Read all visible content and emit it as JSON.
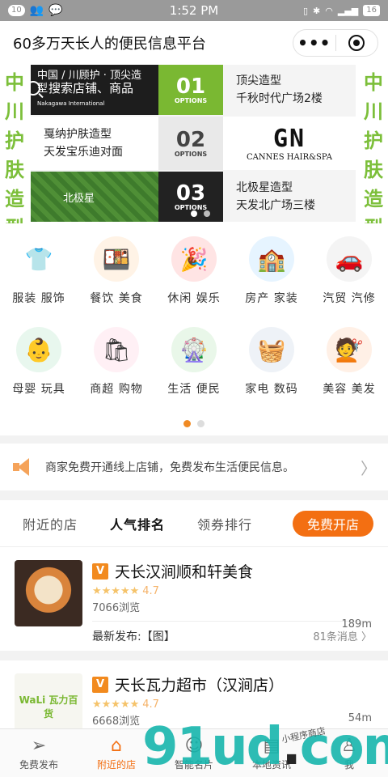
{
  "status": {
    "badge1": "10",
    "time": "1:52 PM",
    "battery": "16"
  },
  "header": {
    "title": "60多万天长人的便民信息平台"
  },
  "banner": {
    "side_left": [
      "中",
      "川",
      "护",
      "肤",
      "造",
      "型"
    ],
    "side_right": [
      "中",
      "川",
      "护",
      "肤",
      "造",
      "型"
    ],
    "search_placeholder": "搜索店铺、商品",
    "slide1_logo": "中国 / 川顾护 · 顶尖造型",
    "slide1_sub": "Nakagawa International",
    "n1": "01",
    "n2": "02",
    "n3": "03",
    "options": "OPTIONS",
    "shop1_line1": "顶尖造型",
    "shop1_line2": "千秋时代广场2楼",
    "shop2_line1": "戛纳护肤造型",
    "shop2_line2": "天发宝乐迪对面",
    "gn_big": "GN",
    "gn_small": "CANNES HAIR&SPA",
    "slide3_logo": "北极星",
    "shop3_line1": "北极星造型",
    "shop3_line2": "天发北广场三楼"
  },
  "categories": [
    {
      "label": "服装 服饰",
      "icon": "tshirt-icon",
      "glyph": "👕",
      "bg": "#ffffff"
    },
    {
      "label": "餐饮 美食",
      "icon": "food-icon",
      "glyph": "🍱",
      "bg": "#fff3e6"
    },
    {
      "label": "休闲 娱乐",
      "icon": "party-icon",
      "glyph": "🎉",
      "bg": "#ffe4e4"
    },
    {
      "label": "房产 家装",
      "icon": "house-icon",
      "glyph": "🏫",
      "bg": "#e6f4ff"
    },
    {
      "label": "汽贸 汽修",
      "icon": "car-icon",
      "glyph": "🚗",
      "bg": "#f4f4f4"
    },
    {
      "label": "母婴 玩具",
      "icon": "baby-icon",
      "glyph": "👶",
      "bg": "#e8f7ee"
    },
    {
      "label": "商超 购物",
      "icon": "shopping-icon",
      "glyph": "🛍",
      "bg": "#fff0f5"
    },
    {
      "label": "生活 便民",
      "icon": "life-icon",
      "glyph": "🎡",
      "bg": "#e9f7e9"
    },
    {
      "label": "家电 数码",
      "icon": "appliance-icon",
      "glyph": "🧺",
      "bg": "#eef2f7"
    },
    {
      "label": "美容 美发",
      "icon": "beauty-icon",
      "glyph": "💇",
      "bg": "#fff0e6"
    }
  ],
  "notice": {
    "text": "商家免费开通线上店铺，免费发布生活便民信息。"
  },
  "tabs": {
    "items": [
      "附近的店",
      "人气排名",
      "领券排行"
    ],
    "open_button": "免费开店"
  },
  "shops": [
    {
      "badge": "V",
      "name": "天长汉涧顺和轩美食",
      "stars": "★★★★★",
      "rating": "4.7",
      "views": "7066浏览",
      "distance": "189m",
      "latest": "最新发布:【图】",
      "messages": "81条消息",
      "thumb_color": "#c96a3a"
    },
    {
      "badge": "V",
      "name": "天长瓦力超市（汉涧店）",
      "stars": "★★★★★",
      "rating": "4.7",
      "views": "6668浏览",
      "distance": "54m",
      "thumb_text": "WaLi 瓦力百货"
    }
  ],
  "tabbar": [
    {
      "label": "免费发布",
      "icon": "send-icon",
      "glyph": "➢"
    },
    {
      "label": "附近的店",
      "icon": "store-icon",
      "glyph": "⌂"
    },
    {
      "label": "智能名片",
      "icon": "card-icon",
      "glyph": "☺"
    },
    {
      "label": "本地资讯",
      "icon": "news-icon",
      "glyph": "▤"
    },
    {
      "label": "我",
      "icon": "profile-icon",
      "glyph": "♙"
    }
  ],
  "watermark": {
    "main": "91ud",
    "dot": ".",
    "tld": "com",
    "small": "小程序商店"
  }
}
